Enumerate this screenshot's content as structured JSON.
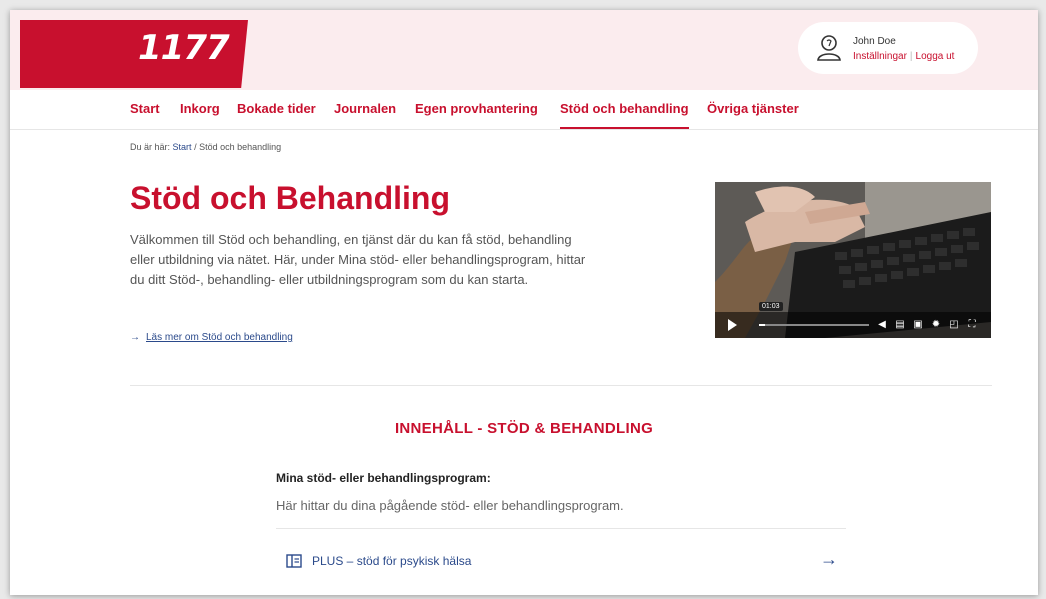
{
  "brand": {
    "logo_text": "1177",
    "accent_color": "#c8102e",
    "header_bg": "#fbecee",
    "link_color": "#2b4a8b"
  },
  "user": {
    "name": "John Doe",
    "settings_label": "Inställningar",
    "logout_label": "Logga ut",
    "icon": "user-icon"
  },
  "nav": {
    "items": [
      {
        "label": "Start"
      },
      {
        "label": "Inkorg"
      },
      {
        "label": "Bokade tider"
      },
      {
        "label": "Journalen"
      },
      {
        "label": "Egen provhantering"
      },
      {
        "label": "Stöd och behandling",
        "active": true
      },
      {
        "label": "Övriga tjänster"
      }
    ]
  },
  "breadcrumb": {
    "prefix": "Du är här:",
    "start": "Start",
    "separator": "/",
    "current": "Stöd och behandling"
  },
  "hero": {
    "title": "Stöd och Behandling",
    "intro": "Välkommen till Stöd och behandling, en tjänst där du kan få stöd, behandling eller utbildning via nätet. Här, under Mina stöd- eller behandlingsprogram, hittar du ditt Stöd-, behandling- eller utbildningsprogram som du kan starta.",
    "read_more_arrow": "→",
    "read_more": "Läs mer om Stöd och behandling"
  },
  "video": {
    "time": "01:03",
    "progress": 0.05,
    "icons": [
      "play-icon",
      "volume-icon",
      "subtitles-icon",
      "transcript-icon",
      "settings-icon",
      "pip-icon",
      "fullscreen-icon"
    ]
  },
  "content": {
    "section_title": "INNEHÅLL - STÖD & BEHANDLING",
    "programs_heading": "Mina stöd- eller behandlingsprogram:",
    "programs_desc": "Här hittar du dina pågående stöd- eller behandlingsprogram.",
    "programs": [
      {
        "label": "PLUS – stöd för psykisk hälsa",
        "arrow": "→"
      }
    ]
  }
}
